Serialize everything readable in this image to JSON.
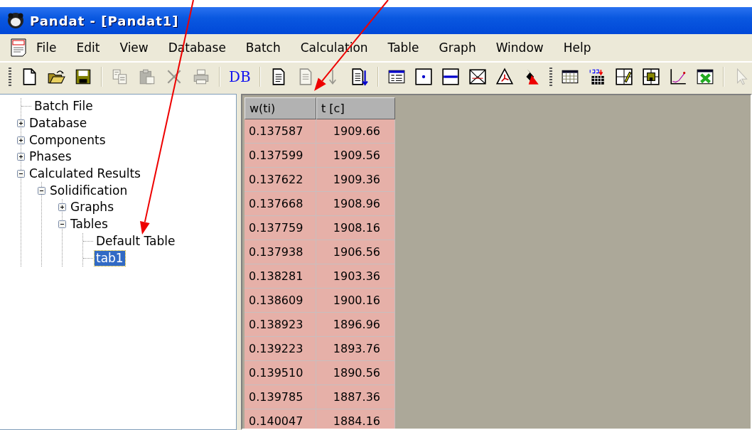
{
  "window": {
    "title": "Pandat - [Pandat1]"
  },
  "menu": [
    {
      "label": "File"
    },
    {
      "label": "Edit"
    },
    {
      "label": "View"
    },
    {
      "label": "Database"
    },
    {
      "label": "Batch"
    },
    {
      "label": "Calculation"
    },
    {
      "label": "Table"
    },
    {
      "label": "Graph"
    },
    {
      "label": "Window"
    },
    {
      "label": "Help"
    }
  ],
  "toolbar": [
    {
      "kind": "grip"
    },
    {
      "kind": "button",
      "disabled": false
    },
    {
      "kind": "button",
      "disabled": false
    },
    {
      "kind": "button",
      "disabled": false
    },
    {
      "kind": "separator"
    },
    {
      "kind": "button",
      "disabled": true
    },
    {
      "kind": "button",
      "disabled": true
    },
    {
      "kind": "button",
      "disabled": true
    },
    {
      "kind": "button",
      "disabled": true
    },
    {
      "kind": "separator"
    },
    {
      "kind": "text",
      "text": "DB",
      "disabled": false
    },
    {
      "kind": "separator"
    },
    {
      "kind": "button",
      "disabled": false
    },
    {
      "kind": "button",
      "disabled": true
    },
    {
      "kind": "button",
      "disabled": true
    },
    {
      "kind": "button",
      "disabled": false
    },
    {
      "kind": "separator"
    },
    {
      "kind": "button",
      "disabled": false
    },
    {
      "kind": "button",
      "disabled": false
    },
    {
      "kind": "button",
      "disabled": false
    },
    {
      "kind": "button",
      "disabled": false
    },
    {
      "kind": "button",
      "disabled": false
    },
    {
      "kind": "button",
      "disabled": false
    },
    {
      "kind": "grip"
    },
    {
      "kind": "button",
      "disabled": false
    },
    {
      "kind": "button",
      "disabled": false
    },
    {
      "kind": "button",
      "disabled": false
    },
    {
      "kind": "button",
      "disabled": false
    },
    {
      "kind": "button",
      "disabled": false
    },
    {
      "kind": "button",
      "disabled": false
    },
    {
      "kind": "separator"
    },
    {
      "kind": "button",
      "disabled": true
    }
  ],
  "tree": [
    {
      "label": "Batch File",
      "selected": false
    },
    {
      "label": "Database",
      "expanded": false,
      "selected": false
    },
    {
      "label": "Components",
      "expanded": false,
      "selected": false
    },
    {
      "label": "Phases",
      "expanded": false,
      "selected": false
    },
    {
      "label": "Calculated Results",
      "expanded": true,
      "selected": false,
      "children": [
        {
          "label": "Solidification",
          "expanded": true,
          "selected": false,
          "children": [
            {
              "label": "Graphs",
              "expanded": false,
              "selected": false
            },
            {
              "label": "Tables",
              "expanded": true,
              "selected": false,
              "children": [
                {
                  "label": "Default Table",
                  "selected": false
                },
                {
                  "label": "tab1",
                  "selected": true
                }
              ]
            }
          ]
        }
      ]
    }
  ],
  "table": {
    "columns": [
      "w(ti)",
      "t [c]"
    ],
    "rows": [
      [
        "0.137587",
        "1909.66"
      ],
      [
        "0.137599",
        "1909.56"
      ],
      [
        "0.137622",
        "1909.36"
      ],
      [
        "0.137668",
        "1908.96"
      ],
      [
        "0.137759",
        "1908.16"
      ],
      [
        "0.137938",
        "1906.56"
      ],
      [
        "0.138281",
        "1903.36"
      ],
      [
        "0.138609",
        "1900.16"
      ],
      [
        "0.138923",
        "1896.96"
      ],
      [
        "0.139223",
        "1893.76"
      ],
      [
        "0.139510",
        "1890.56"
      ],
      [
        "0.139785",
        "1887.36"
      ],
      [
        "0.140047",
        "1884.16"
      ]
    ]
  },
  "annotations": [
    {
      "kind": "arrow"
    },
    {
      "kind": "arrow"
    }
  ]
}
